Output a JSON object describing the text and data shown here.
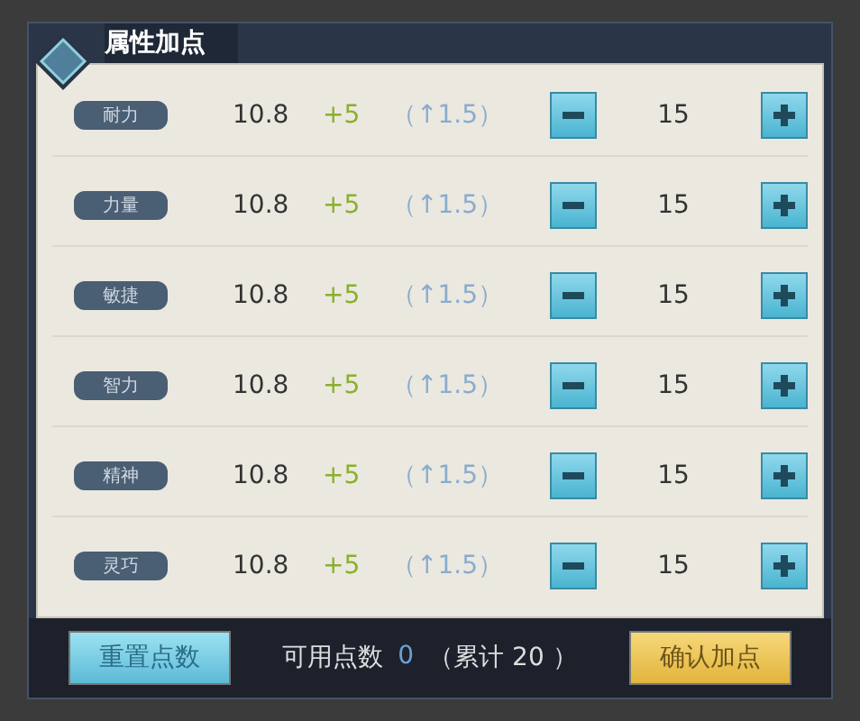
{
  "title": "属性加点",
  "attributes": [
    {
      "name": "耐力",
      "value": "10.8",
      "bonus": "+5",
      "growth": "（↑1.5）",
      "points": "15"
    },
    {
      "name": "力量",
      "value": "10.8",
      "bonus": "+5",
      "growth": "（↑1.5）",
      "points": "15"
    },
    {
      "name": "敏捷",
      "value": "10.8",
      "bonus": "+5",
      "growth": "（↑1.5）",
      "points": "15"
    },
    {
      "name": "智力",
      "value": "10.8",
      "bonus": "+5",
      "growth": "（↑1.5）",
      "points": "15"
    },
    {
      "name": "精神",
      "value": "10.8",
      "bonus": "+5",
      "growth": "（↑1.5）",
      "points": "15"
    },
    {
      "name": "灵巧",
      "value": "10.8",
      "bonus": "+5",
      "growth": "（↑1.5）",
      "points": "15"
    }
  ],
  "footer": {
    "reset_button": "重置点数",
    "available_label": "可用点数",
    "available_value": "0",
    "total": "（累计 20 ）",
    "confirm_button": "确认加点"
  }
}
